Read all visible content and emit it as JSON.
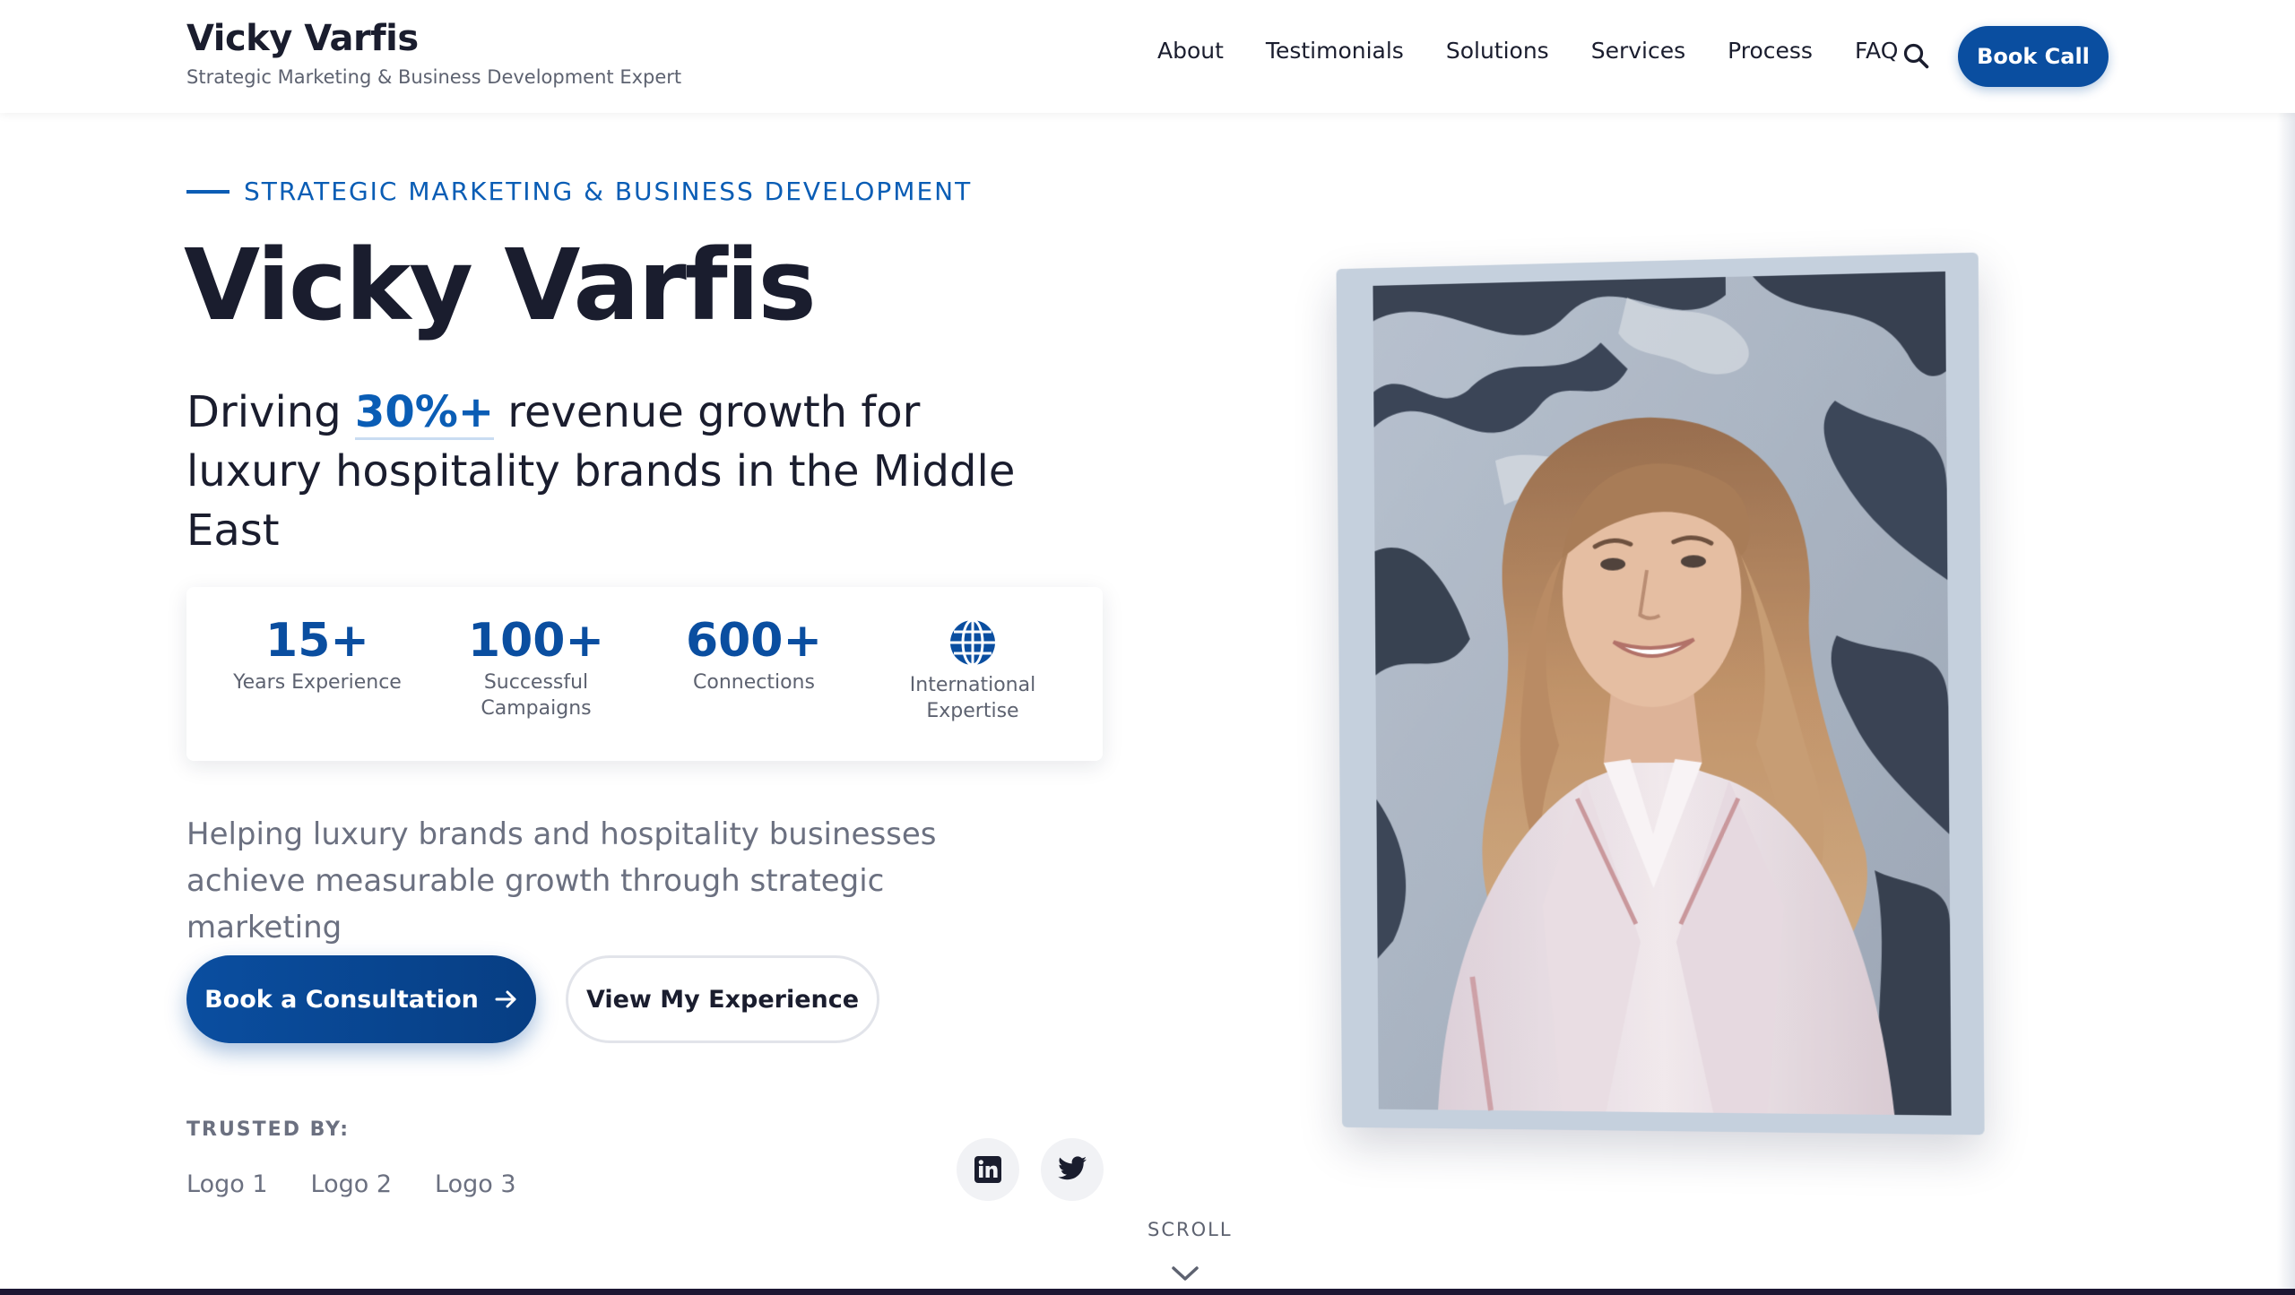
{
  "header": {
    "brand_name": "Vicky Varfis",
    "brand_tagline": "Strategic Marketing & Business Development Expert",
    "nav": [
      "About",
      "Testimonials",
      "Solutions",
      "Services",
      "Process",
      "FAQ"
    ],
    "search_icon": "search-icon",
    "cta_label": "Book Call"
  },
  "hero": {
    "eyebrow": "STRATEGIC MARKETING & BUSINESS DEVELOPMENT",
    "name": "Vicky Varfis",
    "headline_pre": "Driving ",
    "headline_highlight": "30%+",
    "headline_post": " revenue growth for luxury hospitality brands in the Middle East",
    "stats": [
      {
        "value": "15+",
        "label": "Years Experience"
      },
      {
        "value": "100+",
        "label": "Successful Campaigns"
      },
      {
        "value": "600+",
        "label": "Connections"
      },
      {
        "icon": "globe-icon",
        "label": "International Expertise"
      }
    ],
    "description": "Helping luxury brands and hospitality businesses achieve measurable growth through strategic marketing",
    "primary_cta": "Book a Consultation",
    "secondary_cta": "View My Experience",
    "trusted_label": "TRUSTED BY:",
    "logos": [
      "Logo 1",
      "Logo 2",
      "Logo 3"
    ],
    "social": [
      {
        "icon": "linkedin-icon"
      },
      {
        "icon": "twitter-icon"
      }
    ],
    "scroll_label": "SCROLL"
  },
  "colors": {
    "accent": "#0a4ea0",
    "text_dark": "#1a1d2e",
    "muted": "#6b7080"
  }
}
